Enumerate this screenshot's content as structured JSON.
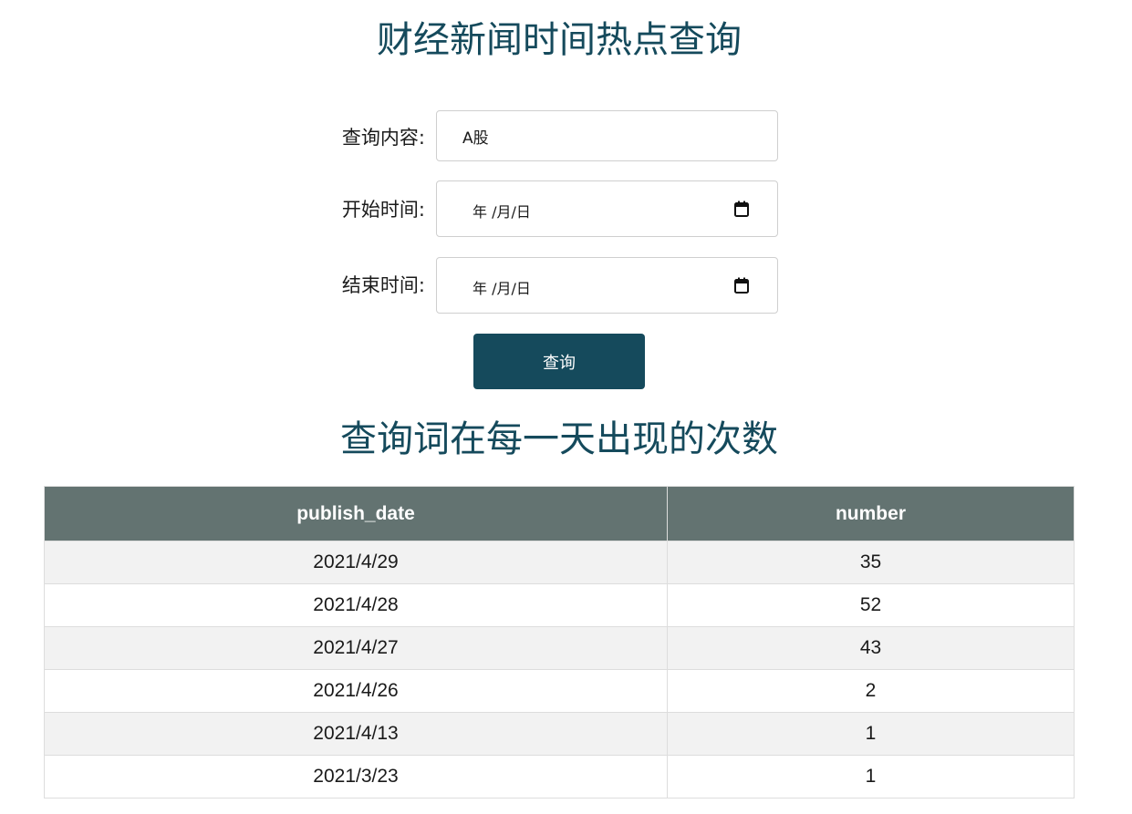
{
  "header": {
    "title": "财经新闻时间热点查询"
  },
  "form": {
    "query_label": "查询内容:",
    "query_value": "A股",
    "start_label": "开始时间:",
    "start_placeholder": "年 /月/日",
    "end_label": "结束时间:",
    "end_placeholder": "年 /月/日",
    "submit_label": "查询"
  },
  "results": {
    "title": "查询词在每一天出现的次数",
    "columns": [
      "publish_date",
      "number"
    ],
    "rows": [
      {
        "publish_date": "2021/4/29",
        "number": "35"
      },
      {
        "publish_date": "2021/4/28",
        "number": "52"
      },
      {
        "publish_date": "2021/4/27",
        "number": "43"
      },
      {
        "publish_date": "2021/4/26",
        "number": "2"
      },
      {
        "publish_date": "2021/4/13",
        "number": "1"
      },
      {
        "publish_date": "2021/3/23",
        "number": "1"
      }
    ]
  },
  "colors": {
    "accent": "#154a5c",
    "table_header": "#637371",
    "row_alt": "#f2f2f2"
  },
  "icons": {
    "date_picker": "calendar-icon"
  }
}
